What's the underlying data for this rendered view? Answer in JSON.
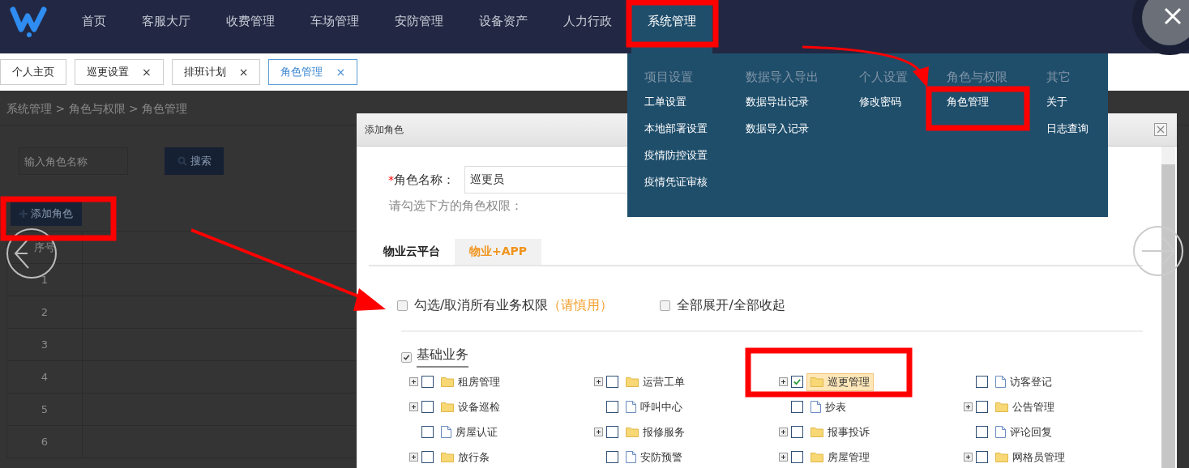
{
  "nav": {
    "items": [
      {
        "label": "首页",
        "selected": false
      },
      {
        "label": "客服大厅",
        "selected": false
      },
      {
        "label": "收费管理",
        "selected": false
      },
      {
        "label": "车场管理",
        "selected": false
      },
      {
        "label": "安防管理",
        "selected": false
      },
      {
        "label": "设备资产",
        "selected": false
      },
      {
        "label": "人力行政",
        "selected": false
      },
      {
        "label": "系统管理",
        "selected": true
      }
    ]
  },
  "tabs": [
    {
      "label": "个人主页",
      "closable": false,
      "selected": false
    },
    {
      "label": "巡更设置",
      "closable": true,
      "selected": false
    },
    {
      "label": "排班计划",
      "closable": true,
      "selected": false
    },
    {
      "label": "角色管理",
      "closable": true,
      "selected": true
    }
  ],
  "close_mark": "×",
  "menu": {
    "columns": [
      {
        "heading": "项目设置",
        "items": [
          "工单设置",
          "本地部署设置",
          "疫情防控设置",
          "疫情凭证审核"
        ]
      },
      {
        "heading": "数据导入导出",
        "items": [
          "数据导出记录",
          "数据导入记录"
        ]
      },
      {
        "heading": "个人设置",
        "items": [
          "修改密码"
        ]
      },
      {
        "heading": "角色与权限",
        "items": [
          "角色管理"
        ]
      },
      {
        "heading": "其它",
        "items": [
          "关于",
          "日志查询"
        ]
      }
    ]
  },
  "page": {
    "breadcrumb": "系统管理 > 角色与权限 > 角色管理",
    "search_placeholder": "输入角色名称",
    "search_button": "搜索",
    "add_button": "添加角色",
    "table": {
      "columns": [
        "序号"
      ],
      "rows": [
        "1",
        "2",
        "3",
        "4",
        "5",
        "6"
      ]
    }
  },
  "dialog": {
    "title": "添加角色",
    "required_mark": "*",
    "name_label": "角色名称：",
    "name_value": "巡更员",
    "hint": "请勾选下方的角色权限：",
    "tabs": [
      {
        "label": "物业云平台",
        "selected": true
      },
      {
        "label": "物业+APP",
        "selected": false
      }
    ],
    "options": [
      {
        "label": "勾选/取消所有业务权限",
        "note": "（请慎用）",
        "checked": false
      },
      {
        "label": "全部展开/全部收起",
        "checked": false
      }
    ],
    "group": {
      "label": "基础业务",
      "checked": true,
      "items": [
        {
          "label": "租房管理",
          "kind": "folder",
          "expandable": true,
          "checked": false,
          "selected": false
        },
        {
          "label": "运营工单",
          "kind": "folder",
          "expandable": true,
          "checked": false,
          "selected": false
        },
        {
          "label": "巡更管理",
          "kind": "folder",
          "expandable": true,
          "checked": true,
          "selected": true
        },
        {
          "label": "访客登记",
          "kind": "file",
          "expandable": false,
          "checked": false,
          "selected": false
        },
        {
          "label": "设备巡检",
          "kind": "folder",
          "expandable": true,
          "checked": false,
          "selected": false
        },
        {
          "label": "呼叫中心",
          "kind": "file",
          "expandable": false,
          "checked": false,
          "selected": false
        },
        {
          "label": "抄表",
          "kind": "file",
          "expandable": false,
          "checked": false,
          "selected": false
        },
        {
          "label": "公告管理",
          "kind": "folder",
          "expandable": true,
          "checked": false,
          "selected": false
        },
        {
          "label": "房屋认证",
          "kind": "file",
          "expandable": false,
          "checked": false,
          "selected": false
        },
        {
          "label": "报修服务",
          "kind": "folder",
          "expandable": true,
          "checked": false,
          "selected": false
        },
        {
          "label": "报事投诉",
          "kind": "folder",
          "expandable": true,
          "checked": false,
          "selected": false
        },
        {
          "label": "评论回复",
          "kind": "file",
          "expandable": false,
          "checked": false,
          "selected": false
        },
        {
          "label": "放行条",
          "kind": "folder",
          "expandable": true,
          "checked": false,
          "selected": false
        },
        {
          "label": "安防预警",
          "kind": "file",
          "expandable": false,
          "checked": false,
          "selected": false
        },
        {
          "label": "房屋管理",
          "kind": "folder",
          "expandable": true,
          "checked": false,
          "selected": false
        },
        {
          "label": "网格员管理",
          "kind": "folder",
          "expandable": true,
          "checked": false,
          "selected": false
        }
      ]
    }
  }
}
